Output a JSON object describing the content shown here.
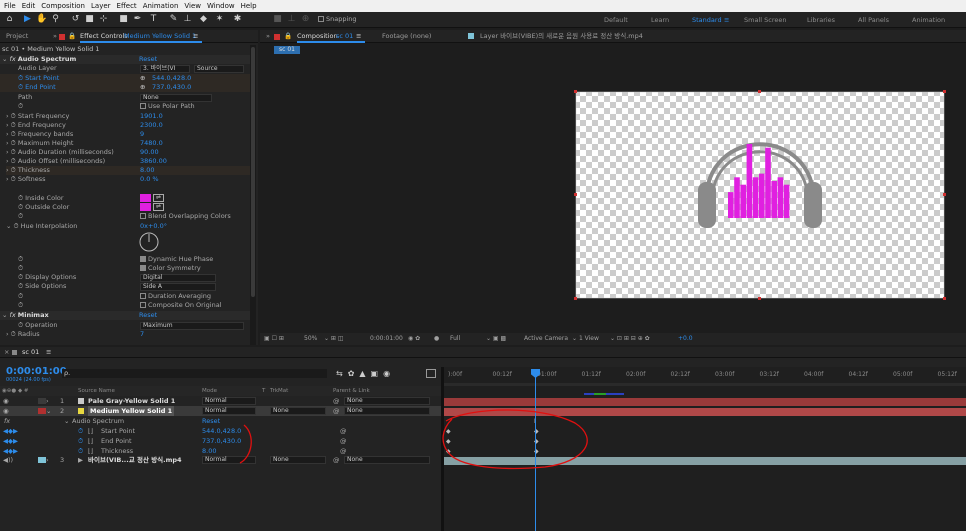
{
  "menu": [
    "File",
    "Edit",
    "Composition",
    "Layer",
    "Effect",
    "Animation",
    "View",
    "Window",
    "Help"
  ],
  "toolbar": {
    "snapping": "Snapping",
    "workspaces": [
      "Default",
      "Learn",
      "Standard",
      "Small Screen",
      "Libraries",
      "All Panels",
      "Animation"
    ]
  },
  "effect_controls": {
    "tabs": {
      "project": "Project",
      "ec_prefix": "Effect Controls",
      "ec_layer": "Medium Yellow Solid 1"
    },
    "breadcrumb": "sc 01 • Medium Yellow Solid 1",
    "fx_name": "Audio Spectrum",
    "reset": "Reset",
    "audio_layer": {
      "label": "Audio Layer",
      "value": "3. 바이브(VI",
      "source": "Source"
    },
    "start_point": {
      "label": "Start Point",
      "value": "544.0,428.0"
    },
    "end_point": {
      "label": "End Point",
      "value": "737.0,430.0"
    },
    "path": {
      "label": "Path",
      "value": "None"
    },
    "use_polar": "Use Polar Path",
    "props": [
      {
        "label": "Start Frequency",
        "value": "1901.0"
      },
      {
        "label": "End Frequency",
        "value": "2300.0"
      },
      {
        "label": "Frequency bands",
        "value": "9"
      },
      {
        "label": "Maximum Height",
        "value": "7480.0"
      },
      {
        "label": "Audio Duration (milliseconds)",
        "value": "90.00"
      },
      {
        "label": "Audio Offset (milliseconds)",
        "value": "3860.00"
      },
      {
        "label": "Thickness",
        "value": "8.00"
      },
      {
        "label": "Softness",
        "value": "0.0 %"
      }
    ],
    "inside_color": "Inside Color",
    "outside_color": "Outside Color",
    "blend_overlap": "Blend Overlapping Colors",
    "hue_interp": {
      "label": "Hue Interpolation",
      "value": "0x+0.0°"
    },
    "dynamic_hue": "Dynamic Hue Phase",
    "color_symmetry": "Color Symmetry",
    "display_options": {
      "label": "Display Options",
      "value": "Digital"
    },
    "side_options": {
      "label": "Side Options",
      "value": "Side A"
    },
    "duration_avg": "Duration Averaging",
    "composite_orig": "Composite On Original",
    "fx2_name": "Minimax",
    "operation": {
      "label": "Operation",
      "value": "Maximum"
    },
    "radius": {
      "label": "Radius",
      "value": "7"
    },
    "swatch_color": "#e020e0"
  },
  "composition": {
    "tab": "Composition",
    "comp_name": "sc 01",
    "footage": "Footage (none)",
    "layer_tab": "Layer 바이브(VIBE)의 새로운 음원 사용료 정산 방식.mp4",
    "subtab": "sc 01",
    "bar": {
      "zoom": "50%",
      "time": "0:00:01:00",
      "quality": "Full",
      "camera": "Active Camera",
      "views": "1 View",
      "exposure": "+0.0"
    },
    "spectrum_bars": [
      0.35,
      0.55,
      0.45,
      1.0,
      0.55,
      0.6,
      0.95,
      0.5,
      0.55,
      0.45
    ],
    "accent": "#e020e0",
    "headphone": "#8a8a8a"
  },
  "timeline": {
    "tab": "sc 01",
    "timecode": "0:00:01:00",
    "fps": "00024 (24.00 fps)",
    "search_placeholder": "ρ.",
    "columns": {
      "source": "Source Name",
      "mode": "Mode",
      "t": "T",
      "trkmat": "TrkMat",
      "parent": "Parent & Link"
    },
    "ruler": [
      "):00f",
      "00:12f",
      "01:00f",
      "01:12f",
      "02:00f",
      "02:12f",
      "03:00f",
      "03:12f",
      "04:00f",
      "04:12f",
      "05:00f",
      "05:12f"
    ],
    "layers": [
      {
        "num": "1",
        "name": "Pale Gray-Yellow Solid 1",
        "mode": "Normal",
        "trkmat": "",
        "parent": "None",
        "color": "#c8c8c8"
      },
      {
        "num": "2",
        "name": "Medium Yellow Solid 1",
        "mode": "Normal",
        "trkmat": "None",
        "parent": "None",
        "color": "#e8d840"
      }
    ],
    "effect_group": {
      "name": "Audio Spectrum",
      "reset": "Reset"
    },
    "keyed": [
      {
        "name": "Start Point",
        "value": "544.0,428.0"
      },
      {
        "name": "End Point",
        "value": "737.0,430.0"
      },
      {
        "name": "Thickness",
        "value": "8.00"
      }
    ],
    "layer3": {
      "num": "3",
      "name": "바이브(VIB...교 정산 방식.mp4",
      "mode": "Normal",
      "trkmat": "None",
      "parent": "None"
    }
  }
}
